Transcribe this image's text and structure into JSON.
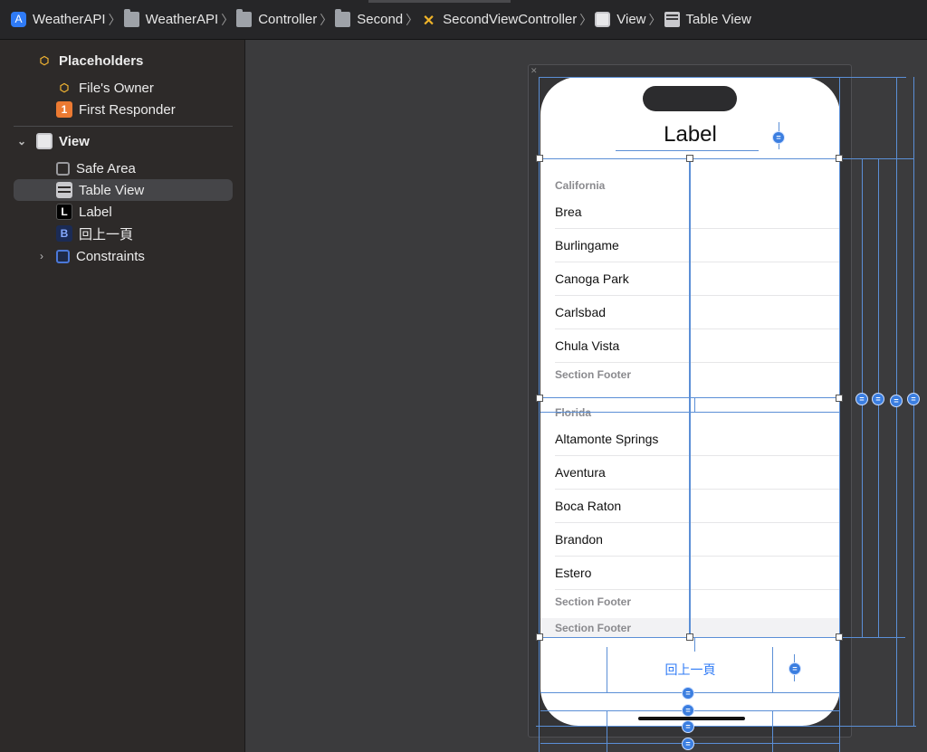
{
  "breadcrumb": [
    {
      "label": "WeatherAPI",
      "icon": "app-icon"
    },
    {
      "label": "WeatherAPI",
      "icon": "folder-icon"
    },
    {
      "label": "Controller",
      "icon": "folder-icon"
    },
    {
      "label": "Second",
      "icon": "folder-icon"
    },
    {
      "label": "SecondViewController",
      "icon": "view-controller-icon"
    },
    {
      "label": "View",
      "icon": "view-icon"
    },
    {
      "label": "Table View",
      "icon": "table-view-icon"
    }
  ],
  "outline": {
    "placeholders": "Placeholders",
    "files_owner": "File's Owner",
    "first_responder": "First Responder",
    "first_responder_badge": "1",
    "view": "View",
    "safe_area": "Safe Area",
    "table_view": "Table View",
    "label": "Label",
    "label_badge": "L",
    "back_button": "回上一頁",
    "back_badge": "B",
    "constraints": "Constraints"
  },
  "scene": {
    "title": "Label",
    "sections": [
      {
        "header": "California",
        "rows": [
          "Brea",
          "Burlingame",
          "Canoga Park",
          "Carlsbad",
          "Chula Vista"
        ],
        "footer": "Section Footer"
      },
      {
        "header": "Florida",
        "rows": [
          "Altamonte Springs",
          "Aventura",
          "Boca Raton",
          "Brandon",
          "Estero"
        ],
        "footer": "Section Footer"
      }
    ],
    "extra_footer": "Section Footer",
    "back_button": "回上一頁",
    "eq_symbol": "="
  },
  "colors": {
    "accent": "#2f7bf6",
    "constraint": "#5b8fd6",
    "selection": "#454548"
  }
}
